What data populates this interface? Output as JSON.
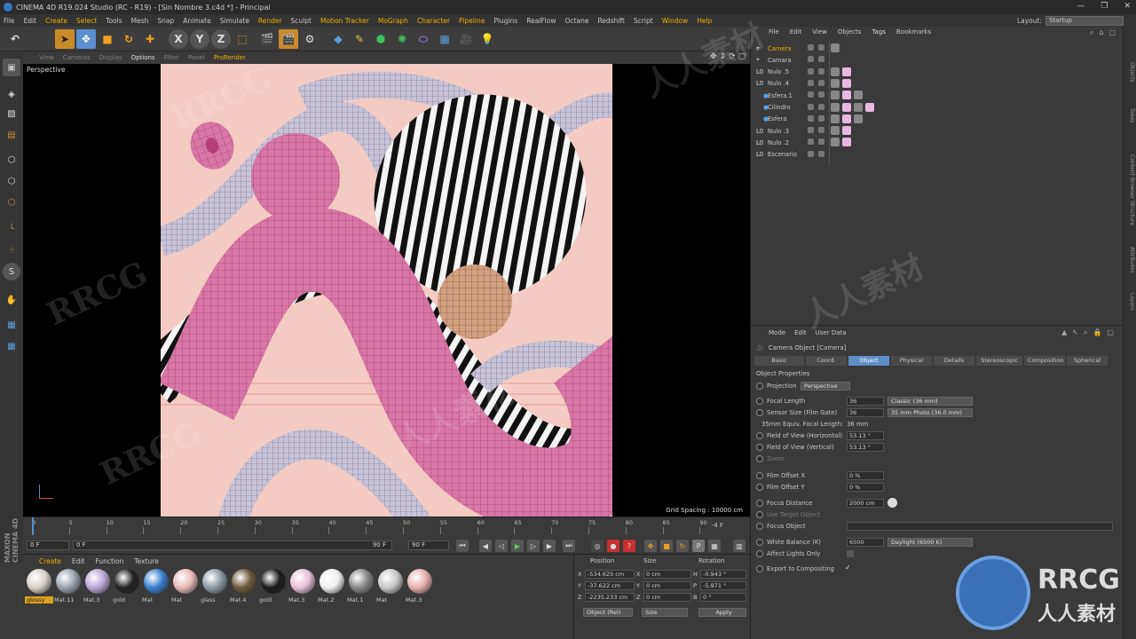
{
  "title": "CINEMA 4D R19.024 Studio (RC - R19) - [Sin Nombre 3.c4d *] - Principal",
  "menu": [
    "File",
    "Edit",
    "Create",
    "Select",
    "Tools",
    "Mesh",
    "Snap",
    "Animate",
    "Simulate",
    "Render",
    "Sculpt",
    "Motion Tracker",
    "MoGraph",
    "Character",
    "Pipeline",
    "Plugins",
    "RealFlow",
    "Octane",
    "Redshift",
    "Script",
    "Window",
    "Help"
  ],
  "layout": {
    "label": "Layout:",
    "value": "Startup"
  },
  "viewport": {
    "menu": [
      "View",
      "Cameras",
      "Display",
      "Options",
      "Filter",
      "Panel",
      "ProRender"
    ],
    "label": "Perspective",
    "grid_spacing": "Grid Spacing : 10000 cm"
  },
  "timeline": {
    "ticks": [
      "0",
      "5",
      "10",
      "15",
      "20",
      "25",
      "30",
      "35",
      "40",
      "45",
      "50",
      "55",
      "60",
      "65",
      "70",
      "75",
      "80",
      "85",
      "90"
    ],
    "end_frame": "-4 F",
    "start_field": "0 F",
    "min_field": "0 F",
    "max_field": "90 F",
    "end_field": "90 F"
  },
  "materials": {
    "tabs": [
      "Create",
      "Edit",
      "Function",
      "Texture"
    ],
    "items": [
      {
        "label": "glossy",
        "color": "#d8d0c8"
      },
      {
        "label": "Mat.11",
        "color": "#9aa3ad"
      },
      {
        "label": "Mat.3",
        "color": "#b9a6d6"
      },
      {
        "label": "gold",
        "color": "#222222"
      },
      {
        "label": "Mat",
        "color": "#3a7fd0"
      },
      {
        "label": "Mat",
        "color": "#e8b8b8"
      },
      {
        "label": "glass",
        "color": "#8e9aa3"
      },
      {
        "label": "Mat.4",
        "color": "#6d5a3a"
      },
      {
        "label": "gold",
        "color": "#1c1c1c"
      },
      {
        "label": "Mat.3",
        "color": "#e8c0d8"
      },
      {
        "label": "Mat.2",
        "color": "#f0f0f0"
      },
      {
        "label": "Mat.1",
        "color": "#888888"
      },
      {
        "label": "Mat",
        "color": "#c8c8c8"
      },
      {
        "label": "Mat.3",
        "color": "#e8b0b0"
      }
    ]
  },
  "coordinates": {
    "headers": [
      "Position",
      "Size",
      "Rotation"
    ],
    "rows": [
      {
        "axis": "X",
        "pos": "-534.625 cm",
        "size_axis": "X",
        "size": "0 cm",
        "rot_axis": "H",
        "rot": "-0.943 °"
      },
      {
        "axis": "Y",
        "pos": "-37.622 cm",
        "size_axis": "Y",
        "size": "0 cm",
        "rot_axis": "P",
        "rot": "-5.971 °"
      },
      {
        "axis": "Z",
        "pos": "-2235.233 cm",
        "size_axis": "Z",
        "size": "0 cm",
        "rot_axis": "B",
        "rot": "0 °"
      }
    ],
    "mode": "Object (Rel)",
    "size_mode": "Size",
    "apply": "Apply"
  },
  "object_manager": {
    "menu": [
      "File",
      "Edit",
      "View",
      "Objects",
      "Tags",
      "Bookmarks"
    ],
    "objects": [
      {
        "name": "Camera",
        "selected": true
      },
      {
        "name": "Camara",
        "selected": false
      },
      {
        "name": "Nulo .5",
        "selected": false
      },
      {
        "name": "Nulo .4",
        "selected": false
      },
      {
        "name": "Esfera.1",
        "selected": false
      },
      {
        "name": "Cilindro",
        "selected": false
      },
      {
        "name": "Esfera",
        "selected": false
      },
      {
        "name": "Nulo .3",
        "selected": false
      },
      {
        "name": "Nulo .2",
        "selected": false
      },
      {
        "name": "Escenario",
        "selected": false
      }
    ]
  },
  "attributes": {
    "menu": [
      "Mode",
      "Edit",
      "User Data"
    ],
    "object_title": "Camera Object [Camera]",
    "tabs": [
      "Basic",
      "Coord.",
      "Object",
      "Physical",
      "Details",
      "Stereoscopic",
      "Composition",
      "Spherical"
    ],
    "active_tab": "Object",
    "section": "Object Properties",
    "projection": {
      "label": "Projection",
      "value": "Perspective"
    },
    "focal_length": {
      "label": "Focal Length",
      "value": "36",
      "preset": "Classic (36 mm)"
    },
    "sensor_size": {
      "label": "Sensor Size (Film Gate)",
      "value": "36",
      "preset": "35 mm Photo (36.0 mm)"
    },
    "equiv": {
      "label": "35mm Equiv. Focal Length:",
      "value": "36 mm"
    },
    "fov_h": {
      "label": "Field of View (Horizontal)",
      "value": "53.13 °"
    },
    "fov_v": {
      "label": "Field of View (Vertical)",
      "value": "53.13 °"
    },
    "zoom": {
      "label": "Zoom"
    },
    "film_x": {
      "label": "Film Offset X",
      "value": "0 %"
    },
    "film_y": {
      "label": "Film Offset Y",
      "value": "0 %"
    },
    "focus_distance": {
      "label": "Focus Distance",
      "value": "2000 cm"
    },
    "use_target": {
      "label": "Use Target Object"
    },
    "focus_object": {
      "label": "Focus Object"
    },
    "white_balance": {
      "label": "White Balance (K)",
      "value": "6500",
      "preset": "Daylight (6500 K)"
    },
    "affect_lights": {
      "label": "Affect Lights Only"
    },
    "export": {
      "label": "Export to Compositing",
      "value": "✓"
    }
  },
  "right_tabs": [
    "Objects",
    "Takes",
    "Content Browser",
    "Structure",
    "Attributes",
    "Layers"
  ],
  "brand": {
    "logo": "RRCG",
    "sub": "人人素材",
    "maxon": "MAXON CINEMA 4D"
  },
  "watermarks": [
    "RRCG",
    "人人素材",
    "RRCG",
    "人人素材",
    "RRCG",
    "人人素材"
  ]
}
